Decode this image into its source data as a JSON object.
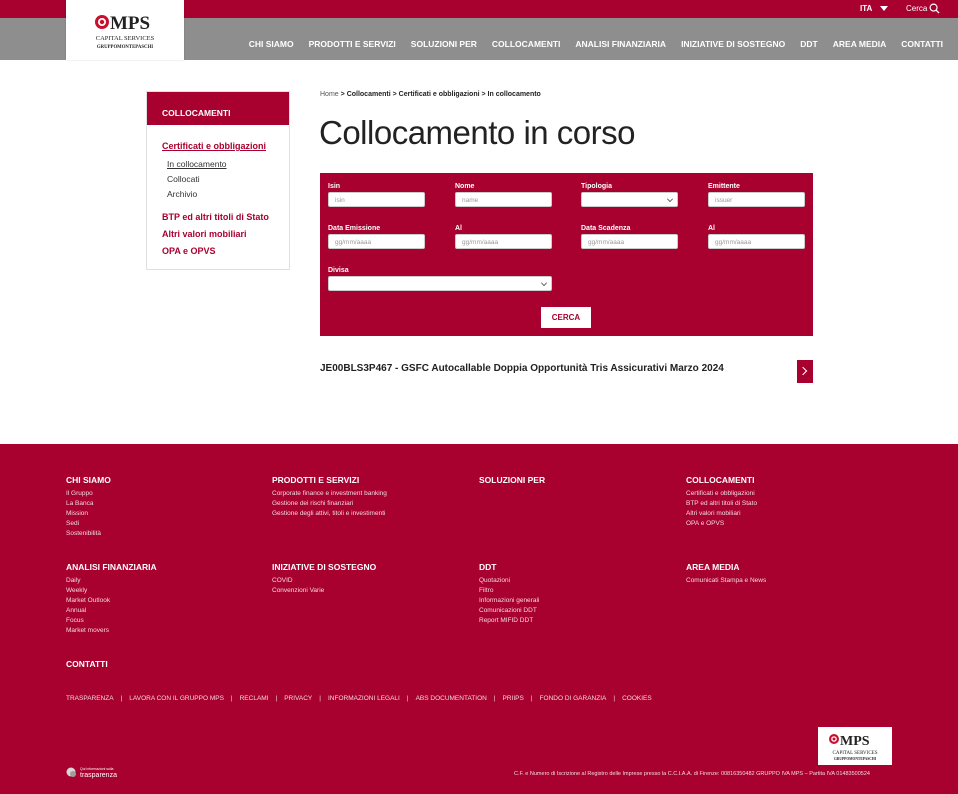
{
  "header": {
    "language": "ITA",
    "search_label": "Cerca",
    "logo": {
      "brand": "MPS",
      "line1": "CAPITAL SERVICES",
      "line2": "GRUPPOMONTEPASCHI"
    },
    "nav": [
      "CHI SIAMO",
      "PRODOTTI E SERVIZI",
      "SOLUZIONI PER",
      "COLLOCAMENTI",
      "ANALISI FINANZIARIA",
      "INIZIATIVE DI SOSTEGNO",
      "DDT",
      "AREA MEDIA",
      "CONTATTI"
    ]
  },
  "sidebar": {
    "title": "COLLOCAMENTI",
    "section": "Certificati e obbligazioni",
    "subitems": [
      "In collocamento",
      "Collocati",
      "Archivio"
    ],
    "items": [
      "BTP ed altri titoli di Stato",
      "Altri valori mobiliari",
      "OPA e OPVS"
    ]
  },
  "breadcrumb": {
    "home": "Home",
    "level1": "Collocamenti",
    "level2": "Certificati e obbligazioni",
    "current": "In collocamento",
    "separator": ">"
  },
  "page_title": "Collocamento in corso",
  "filters": {
    "isin_label": "Isin",
    "isin_placeholder": "isin",
    "nome_label": "Nome",
    "nome_placeholder": "name",
    "tipologia_label": "Tipologia",
    "emittente_label": "Emittente",
    "emittente_placeholder": "issuer",
    "data_emissione_label": "Data Emissione",
    "data_emissione_placeholder": "gg/mm/aaaa",
    "al1_label": "Al",
    "al1_placeholder": "gg/mm/aaaa",
    "data_scadenza_label": "Data Scadenza",
    "data_scadenza_placeholder": "gg/mm/aaaa",
    "al2_label": "Al",
    "al2_placeholder": "gg/mm/aaaa",
    "divisa_label": "Divisa",
    "search_button": "CERCA"
  },
  "result": {
    "title": "JE00BLS3P467 - GSFC Autocallable Doppia Opportunità Tris Assicurativi Marzo 2024"
  },
  "footer": {
    "columns": [
      {
        "title": "CHI SIAMO",
        "links": [
          "Il Gruppo",
          "La Banca",
          "Mission",
          "Sedi",
          "Sostenibilità"
        ]
      },
      {
        "title": "PRODOTTI E SERVIZI",
        "links": [
          "Corporate finance e investment banking",
          "Gestione dei rischi finanziari",
          "Gestione degli attivi, titoli e investimenti"
        ]
      },
      {
        "title": "SOLUZIONI PER",
        "links": []
      },
      {
        "title": "COLLOCAMENTI",
        "links": [
          "Certificati e obbligazioni",
          "BTP ed altri titoli di Stato",
          "Altri valori mobiliari",
          "OPA e OPVS"
        ]
      },
      {
        "title": "ANALISI FINANZIARIA",
        "links": [
          "Daily",
          "Weekly",
          "Market Outlook",
          "Annual",
          "Focus",
          "Market movers"
        ]
      },
      {
        "title": "INIZIATIVE DI SOSTEGNO",
        "links": [
          "COVID",
          "Convenzioni Varie"
        ]
      },
      {
        "title": "DDT",
        "links": [
          "Quotazioni",
          "Filtro",
          "Informazioni generali",
          "Comunicazioni DDT",
          "Report MIFID DDT"
        ]
      },
      {
        "title": "AREA MEDIA",
        "links": [
          "Comunicati Stampa e News"
        ]
      },
      {
        "title": "CONTATTI",
        "links": []
      }
    ],
    "legal_links": [
      "TRASPARENZA",
      "LAVORA CON IL GRUPPO MPS",
      "RECLAMI",
      "PRIVACY",
      "INFORMAZIONI LEGALI",
      "ABS DOCUMENTATION",
      "PRIIPS",
      "FONDO DI GARANZIA",
      "COOKIES"
    ],
    "legal_separator": "|",
    "transparency_badge": {
      "small": "Qui informazioni sulla",
      "big": "trasparenza"
    },
    "copyright": "C.F. e Numero di Iscrizione al Registro delle Imprese presso la C.C.I.A.A. di Firenze: 00816350482 GRUPPO IVA MPS – Partita IVA 01483500524"
  },
  "colors": {
    "brand": "#a8002f",
    "nav_gray": "#8e8e8e",
    "footer_text": "#f3d9df"
  }
}
